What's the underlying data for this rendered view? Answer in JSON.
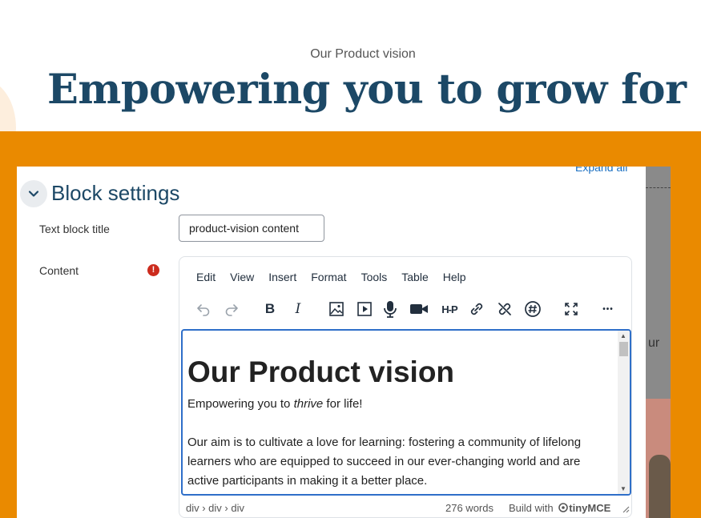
{
  "header": {
    "eyebrow": "Our Product vision",
    "title": "Empowering you to grow for life!"
  },
  "background": {
    "peek_text": "ur"
  },
  "panel": {
    "expand_all": "Expand all",
    "section_title": "Block settings",
    "fields": {
      "title_label": "Text block title",
      "title_value": "product-vision content",
      "content_label": "Content",
      "required_mark": "!"
    }
  },
  "editor": {
    "menu": [
      "Edit",
      "View",
      "Insert",
      "Format",
      "Tools",
      "Table",
      "Help"
    ],
    "toolbar": {
      "bold": "B",
      "italic": "I",
      "h5p": "H-P",
      "more": "•••"
    },
    "content": {
      "heading": "Our Product vision",
      "intro_before": "Empowering you to ",
      "intro_em": "thrive",
      "intro_after": " for life!",
      "paragraph": "Our aim is to cultivate a love for learning: fostering a community of lifelong learners who are equipped to succeed in our ever-changing world and are active participants in making it a better place."
    },
    "status": {
      "path": "div › div › div",
      "word_count": "276 words",
      "branding_prefix": "Build with",
      "branding_name": "tinyMCE"
    }
  },
  "colors": {
    "brand_navy": "#1c4866",
    "band_orange": "#ea8a00",
    "link_blue": "#1a6fc1",
    "focus_blue": "#2f6fc9",
    "required_red": "#cc2b1d"
  }
}
